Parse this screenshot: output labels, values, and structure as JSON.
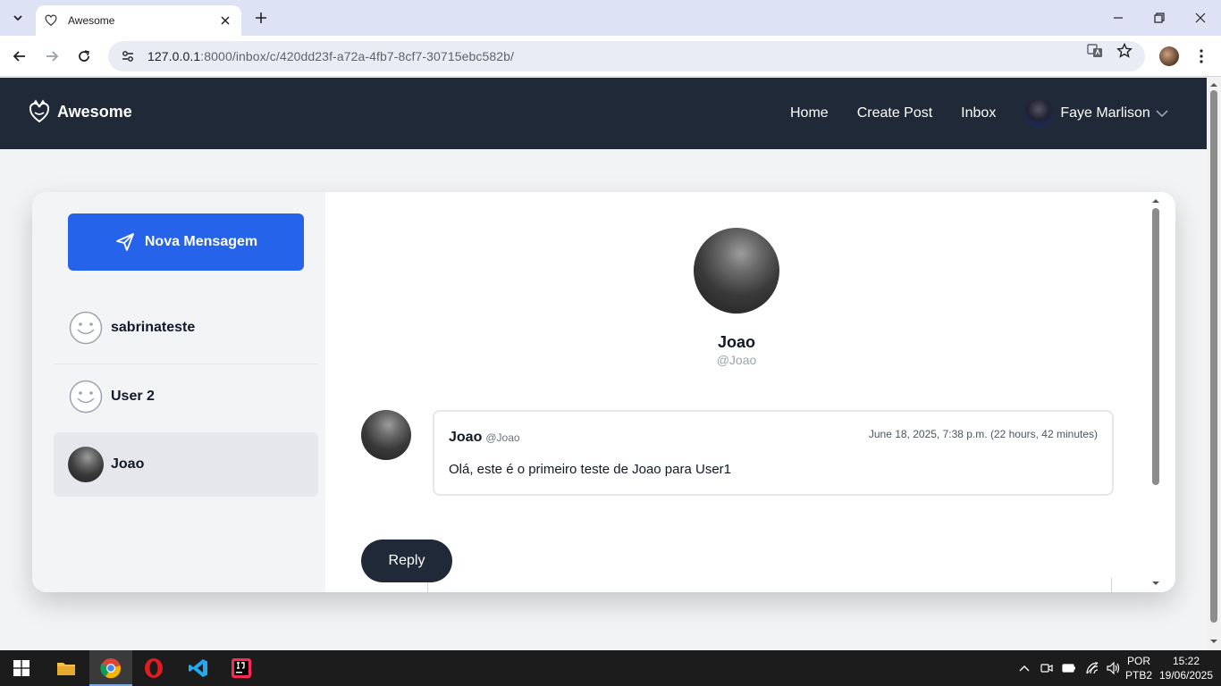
{
  "browser": {
    "tab_title": "Awesome",
    "url_host": "127.0.0.1",
    "url_rest": ":8000/inbox/c/420dd23f-a72a-4fb7-8cf7-30715ebc582b/"
  },
  "site": {
    "brand": "Awesome",
    "nav": {
      "home": "Home",
      "create_post": "Create Post",
      "inbox": "Inbox",
      "user_name": "Faye Marlison"
    }
  },
  "sidebar": {
    "new_message_label": "Nova Mensagem",
    "conversations": [
      {
        "name": "sabrinateste"
      },
      {
        "name": "User 2"
      },
      {
        "name": "Joao"
      }
    ]
  },
  "conversation": {
    "profile_name": "Joao",
    "profile_handle": "@Joao",
    "messages": [
      {
        "sender": "Joao",
        "handle": "@Joao",
        "timestamp": "June 18, 2025, 7:38 p.m. (22 hours, 42 minutes)",
        "text": "Olá, este é o primeiro teste de Joao para User1"
      }
    ],
    "reply_label": "Reply"
  },
  "taskbar": {
    "language": "POR",
    "layout": "PTB2",
    "time": "15:22",
    "date": "19/06/2025"
  }
}
